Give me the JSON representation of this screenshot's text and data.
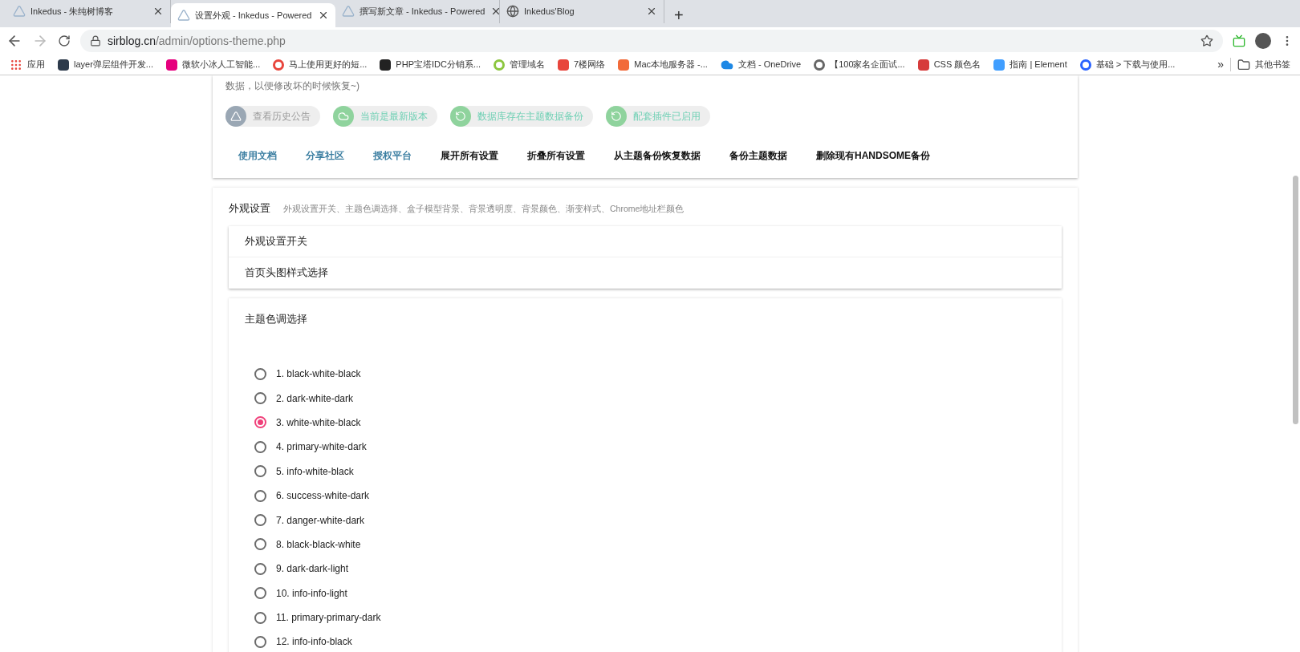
{
  "browser": {
    "tabs": [
      {
        "title": "Inkedus - 朱纯树博客",
        "selected": false,
        "kind": "site"
      },
      {
        "title": "设置外观 - Inkedus - Powered",
        "selected": true,
        "kind": "site"
      },
      {
        "title": "撰写新文章 - Inkedus - Powered",
        "selected": false,
        "kind": "site"
      },
      {
        "title": "Inkedus'Blog",
        "selected": false,
        "kind": "globe"
      }
    ],
    "new_tab": "+",
    "address": {
      "host": "sirblog.cn",
      "path": "/admin/options-theme.php"
    },
    "bookmarks": [
      {
        "label": "应用",
        "kind": "apps",
        "color": "#e8453c"
      },
      {
        "label": "layer弹层组件开发...",
        "kind": "favicon",
        "color": "#2d3a4b"
      },
      {
        "label": "微软小冰人工智能...",
        "kind": "favicon",
        "color": "#e6007e"
      },
      {
        "label": "马上使用更好的短...",
        "kind": "ring",
        "color": "#e8453c"
      },
      {
        "label": "PHP宝塔IDC分销系...",
        "kind": "favicon",
        "color": "#222222"
      },
      {
        "label": "管理域名",
        "kind": "ring",
        "color": "#8cc63f"
      },
      {
        "label": "7楼网络",
        "kind": "favicon",
        "color": "#e8453c"
      },
      {
        "label": "Mac本地服务器 -...",
        "kind": "favicon",
        "color": "#f26b3a"
      },
      {
        "label": "文档 - OneDrive",
        "kind": "cloud",
        "color": "#1e88e5"
      },
      {
        "label": "【100家名企面试...",
        "kind": "ring",
        "color": "#666666"
      },
      {
        "label": "CSS 颜色名",
        "kind": "favicon",
        "color": "#d63b3b"
      },
      {
        "label": "指南 | Element",
        "kind": "favicon",
        "color": "#409eff"
      },
      {
        "label": "基础 > 下载与使用...",
        "kind": "ring",
        "color": "#2962ff"
      }
    ],
    "more": "»",
    "other_bookmarks": "其他书签"
  },
  "page": {
    "intro_text": "数据，以便修改坏的时候恢复~)",
    "badges": [
      {
        "label": "查看历史公告",
        "kind": "notice"
      },
      {
        "label": "当前是最新版本",
        "kind": "update"
      },
      {
        "label": "数据库存在主题数据备份",
        "kind": "backup"
      },
      {
        "label": "配套插件已启用",
        "kind": "backup"
      }
    ],
    "links": [
      {
        "label": "使用文档",
        "kind": "link"
      },
      {
        "label": "分享社区",
        "kind": "link"
      },
      {
        "label": "授权平台",
        "kind": "link"
      },
      {
        "label": "展开所有设置",
        "kind": "action"
      },
      {
        "label": "折叠所有设置",
        "kind": "action"
      },
      {
        "label": "从主题备份恢复数据",
        "kind": "action"
      },
      {
        "label": "备份主题数据",
        "kind": "action"
      },
      {
        "label": "删除现有HANDSOME备份",
        "kind": "action"
      }
    ],
    "section": {
      "title": "外观设置",
      "description": "外观设置开关、主题色调选择、盒子模型背景、背景透明度、背景颜色、渐变样式、Chrome地址栏颜色",
      "panels": [
        {
          "title": "外观设置开关"
        },
        {
          "title": "首页头图样式选择"
        }
      ],
      "theme_panel": {
        "title": "主题色调选择",
        "options": [
          {
            "label": "1. black-white-black",
            "selected": false
          },
          {
            "label": "2. dark-white-dark",
            "selected": false
          },
          {
            "label": "3. white-white-black",
            "selected": true
          },
          {
            "label": "4. primary-white-dark",
            "selected": false
          },
          {
            "label": "5. info-white-black",
            "selected": false
          },
          {
            "label": "6. success-white-dark",
            "selected": false
          },
          {
            "label": "7. danger-white-dark",
            "selected": false
          },
          {
            "label": "8. black-black-white",
            "selected": false
          },
          {
            "label": "9. dark-dark-light",
            "selected": false
          },
          {
            "label": "10. info-info-light",
            "selected": false
          },
          {
            "label": "11. primary-primary-dark",
            "selected": false
          },
          {
            "label": "12. info-info-black",
            "selected": false
          }
        ]
      }
    }
  }
}
